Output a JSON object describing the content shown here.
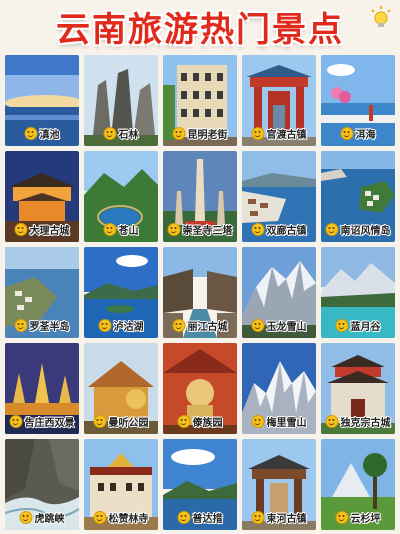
{
  "header": {
    "title": "云南旅游热门景点",
    "icon": "lightbulb-icon"
  },
  "accent_color": "#e02a1c",
  "badge_icon": "smiley-face-icon",
  "spots": [
    {
      "label": "滇池"
    },
    {
      "label": "石林"
    },
    {
      "label": "昆明老街"
    },
    {
      "label": "官渡古镇"
    },
    {
      "label": "洱海"
    },
    {
      "label": "大理古城"
    },
    {
      "label": "苍山"
    },
    {
      "label": "崇圣寺三塔"
    },
    {
      "label": "双廊古镇"
    },
    {
      "label": "南诏风情岛"
    },
    {
      "label": "罗荃半岛"
    },
    {
      "label": "泸沽湖"
    },
    {
      "label": "丽江古城"
    },
    {
      "label": "玉龙雪山"
    },
    {
      "label": "蓝月谷"
    },
    {
      "label": "告庄西双景"
    },
    {
      "label": "曼听公园"
    },
    {
      "label": "傣族园"
    },
    {
      "label": "梅里雪山"
    },
    {
      "label": "独克宗古城"
    },
    {
      "label": "虎跳峡"
    },
    {
      "label": "松赞林寺"
    },
    {
      "label": "普达措"
    },
    {
      "label": "束河古镇"
    },
    {
      "label": "云杉坪"
    }
  ]
}
